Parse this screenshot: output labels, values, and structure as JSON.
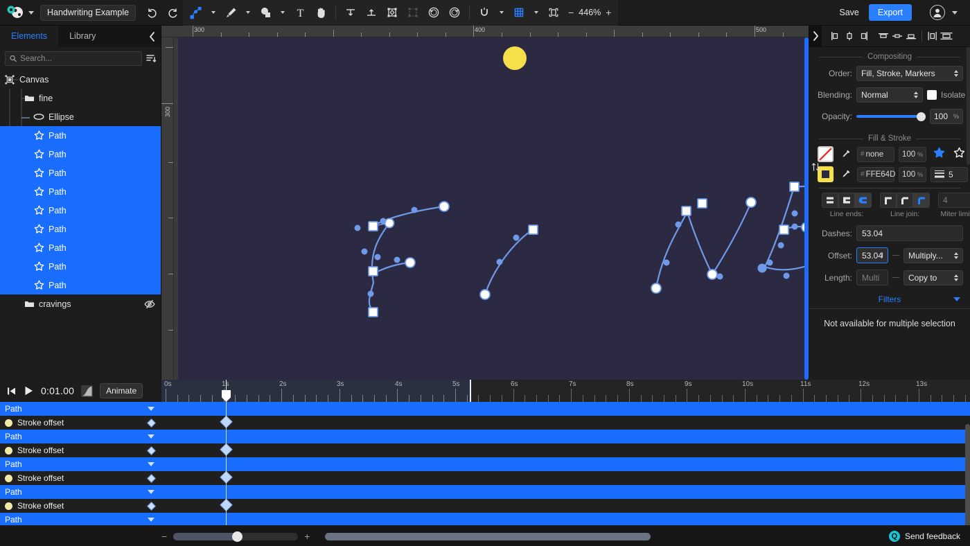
{
  "app": {
    "document_title": "Handwriting Example",
    "zoom_level": "446%",
    "save_label": "Save",
    "export_label": "Export"
  },
  "toolbar": {
    "icons": [
      {
        "name": "app-logo-icon"
      },
      {
        "name": "node-edit-tool-icon"
      },
      {
        "name": "pen-tool-icon"
      },
      {
        "name": "shape-tool-icon"
      },
      {
        "name": "text-tool-icon"
      },
      {
        "name": "hand-tool-icon"
      },
      {
        "name": "align-top-icon"
      },
      {
        "name": "align-middle-icon"
      },
      {
        "name": "transform-box-icon"
      },
      {
        "name": "transform-box-disabled-icon"
      },
      {
        "name": "rotate-icon"
      },
      {
        "name": "group-icon"
      },
      {
        "name": "snap-magnet-icon"
      },
      {
        "name": "snap-grid-icon"
      },
      {
        "name": "fit-to-view-icon"
      }
    ],
    "undo_label": "undo",
    "redo_label": "redo"
  },
  "left_panel": {
    "tabs": [
      {
        "label": "Elements",
        "active": true
      },
      {
        "label": "Library",
        "active": false
      }
    ],
    "search": {
      "placeholder": "Search...",
      "value": ""
    },
    "tree": [
      {
        "label": "Canvas",
        "icon": "canvas-icon",
        "depth": 0,
        "selected": false,
        "hidden": false
      },
      {
        "label": "fine",
        "icon": "folder-icon",
        "depth": 1,
        "selected": false,
        "hidden": false
      },
      {
        "label": "Ellipse",
        "icon": "ellipse-icon",
        "depth": 2,
        "selected": false,
        "hidden": false
      },
      {
        "label": "Path",
        "icon": "path-star-icon",
        "depth": 2,
        "selected": true,
        "hidden": false
      },
      {
        "label": "Path",
        "icon": "path-star-icon",
        "depth": 2,
        "selected": true,
        "hidden": false
      },
      {
        "label": "Path",
        "icon": "path-star-icon",
        "depth": 2,
        "selected": true,
        "hidden": false
      },
      {
        "label": "Path",
        "icon": "path-star-icon",
        "depth": 2,
        "selected": true,
        "hidden": false
      },
      {
        "label": "Path",
        "icon": "path-star-icon",
        "depth": 2,
        "selected": true,
        "hidden": false
      },
      {
        "label": "Path",
        "icon": "path-star-icon",
        "depth": 2,
        "selected": true,
        "hidden": false
      },
      {
        "label": "Path",
        "icon": "path-star-icon",
        "depth": 2,
        "selected": true,
        "hidden": false
      },
      {
        "label": "Path",
        "icon": "path-star-icon",
        "depth": 2,
        "selected": true,
        "hidden": false
      },
      {
        "label": "Path",
        "icon": "path-star-icon",
        "depth": 2,
        "selected": true,
        "hidden": false
      },
      {
        "label": "cravings",
        "icon": "folder-icon",
        "depth": 1,
        "selected": false,
        "hidden": true
      }
    ]
  },
  "canvas": {
    "ruler_h_labels": [
      "300",
      "400",
      "500"
    ],
    "ruler_v_labels": [
      "300"
    ],
    "background_color": "#2b2a42",
    "ellipse_color": "#F5E04A",
    "stroke_color": "#6f9aea",
    "node_color": "#ffffff"
  },
  "right_panel": {
    "align_icons": [
      "align-left-edge-icon",
      "align-center-horizontal-icon",
      "align-right-edge-icon",
      "align-top-edge-icon",
      "align-middle-vertical-icon",
      "align-bottom-edge-icon",
      "distribute-horizontal-icon",
      "distribute-vertical-icon"
    ],
    "compositing": {
      "title": "Compositing",
      "order_label": "Order:",
      "order_value": "Fill, Stroke, Markers",
      "blending_label": "Blending:",
      "blending_value": "Normal",
      "isolate_label": "Isolate",
      "opacity_label": "Opacity:",
      "opacity_value": "100",
      "opacity_unit": "%"
    },
    "fill_stroke": {
      "title": "Fill & Stroke",
      "fill": {
        "hex": "none",
        "hash": "#",
        "alpha": "100",
        "unit": "%",
        "swatch": "none"
      },
      "stroke": {
        "hex": "FFE64D",
        "hash": "#",
        "alpha": "100",
        "unit": "%",
        "width": "5",
        "swatch": "#FFE64D"
      },
      "line_ends_label": "Line ends:",
      "line_join_label": "Line join:",
      "miter_limit_label": "Miter limit",
      "miter_limit_value": "4",
      "line_ends_selected": 2,
      "line_join_selected": 2,
      "dashes_label": "Dashes:",
      "dashes_value": "53.04",
      "offset_label": "Offset:",
      "offset_value": "53.04",
      "offset_action": "Multiply...",
      "length_label": "Length:",
      "length_value": "Multi",
      "length_action": "Copy to"
    },
    "filters": {
      "title": "Filters",
      "message": "Not available for multiple selection"
    }
  },
  "timeline": {
    "current_time": "0:01.00",
    "animate_label": "Animate",
    "play_icon": "play-icon",
    "prev_frame_icon": "skip-to-start-icon",
    "easing_icon": "easing-curve-icon",
    "ruler_labels": [
      "0s",
      "1s",
      "2s",
      "3s",
      "4s",
      "5s",
      "6s",
      "7s",
      "8s",
      "9s",
      "10s",
      "11s",
      "12s",
      "13s"
    ],
    "playhead_time_s": 1,
    "duration_end_s": 5.45,
    "tracks": [
      {
        "label": "Path",
        "type": "object",
        "keyframes": []
      },
      {
        "label": "Stroke offset",
        "type": "property",
        "keyframes": [
          1
        ]
      },
      {
        "label": "Path",
        "type": "object",
        "keyframes": []
      },
      {
        "label": "Stroke offset",
        "type": "property",
        "keyframes": [
          1
        ]
      },
      {
        "label": "Path",
        "type": "object",
        "keyframes": []
      },
      {
        "label": "Stroke offset",
        "type": "property",
        "keyframes": [
          1
        ]
      },
      {
        "label": "Path",
        "type": "object",
        "keyframes": []
      },
      {
        "label": "Stroke offset",
        "type": "property",
        "keyframes": [
          1
        ]
      },
      {
        "label": "Path",
        "type": "object",
        "keyframes": []
      }
    ]
  },
  "status_bar": {
    "zoom_minus": "−",
    "zoom_plus": "+",
    "feedback_label": "Send feedback",
    "feedback_icon": "feedback-icon"
  }
}
